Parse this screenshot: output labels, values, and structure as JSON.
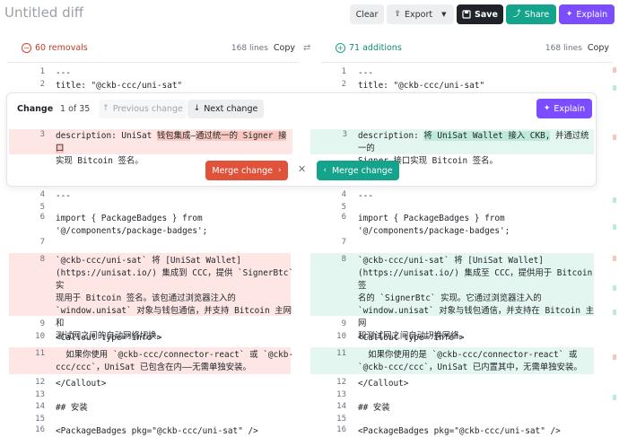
{
  "header": {
    "title": "Untitled diff",
    "clear_label": "Clear",
    "export_label": "Export",
    "save_label": "Save",
    "share_label": "Share",
    "explain_label": "Explain"
  },
  "left_pane": {
    "summary": "60 removals",
    "lines": "168 lines",
    "copy_label": "Copy"
  },
  "right_pane": {
    "summary": "71 additions",
    "lines": "168 lines",
    "copy_label": "Copy"
  },
  "change_panel": {
    "label": "Change",
    "counter": "1 of 35",
    "prev_label": "Previous change",
    "next_label": "Next change",
    "explain_label": "Explain",
    "merge_left_label": "Merge change",
    "merge_right_label": "Merge change"
  },
  "left_lines": {
    "l1": {
      "n": "1",
      "t": "---"
    },
    "l2": {
      "n": "2",
      "t": "title: \"@ckb-ccc/uni-sat\""
    },
    "l3a": "description: UniSat ",
    "l3b": "钱包集成",
    "l3c": "—",
    "l3d": "通过统一的 Signer 接口",
    "l3e": "实现 Bitcoin 签名。",
    "l3n": "3",
    "l4": {
      "n": "4",
      "t": "---"
    },
    "l5": {
      "n": "5",
      "t": ""
    },
    "l6": {
      "n": "6",
      "t": "import { PackageBadges } from\n'@/components/package-badges';"
    },
    "l7": {
      "n": "7",
      "t": ""
    },
    "l8": {
      "n": "8",
      "t": "`@ckb-ccc/uni-sat` 将 [UniSat Wallet]\n(https://unisat.io/) 集成到 CCC，提供 `SignerBtc` 实\n现用于 Bitcoin 签名。该包通过浏览器注入的\n`window.unisat` 对象与钱包通信，并支持 Bitcoin 主网和\n测试网之间的自动网络切换。"
    },
    "l9": {
      "n": "9",
      "t": ""
    },
    "l10": {
      "n": "10",
      "t": "<Callout type=\"info\">"
    },
    "l11": {
      "n": "11",
      "t": "  如果你使用 `@ckb-ccc/connector-react` 或 `@ckb-\nccc/ccc`，UniSat 已包含在内——无需单独安装。"
    },
    "l12": {
      "n": "12",
      "t": "</Callout>"
    },
    "l13": {
      "n": "13",
      "t": ""
    },
    "l14": {
      "n": "14",
      "t": "## 安装"
    },
    "l15": {
      "n": "15",
      "t": ""
    },
    "l16": {
      "n": "16",
      "t": "<PackageBadges pkg=\"@ckb-ccc/uni-sat\" />"
    }
  },
  "right_lines": {
    "r1": {
      "n": "1",
      "t": "---"
    },
    "r2": {
      "n": "2",
      "t": "title: \"@ckb-ccc/uni-sat\""
    },
    "r3a": "description: ",
    "r3b": "将 UniSat Wallet 接入 CKB,",
    "r3c": " 并通过统一的",
    "r3d": "Signer 接口实现 Bitcoin 签名。",
    "r3n": "3",
    "r4": {
      "n": "4",
      "t": "---"
    },
    "r5": {
      "n": "5",
      "t": ""
    },
    "r6": {
      "n": "6",
      "t": "import { PackageBadges } from\n'@/components/package-badges';"
    },
    "r7": {
      "n": "7",
      "t": ""
    },
    "r8": {
      "n": "8",
      "t": "`@ckb-ccc/uni-sat` 将 [UniSat Wallet]\n(https://unisat.io/) 集成至 CCC，提供用于 Bitcoin 签\n名的 `SignerBtc` 实现。它通过浏览器注入的\n`window.unisat` 对象与钱包通信，并支持在 Bitcoin 主网\n和测试网之间自动切换网络。"
    },
    "r9": {
      "n": "9",
      "t": ""
    },
    "r10": {
      "n": "10",
      "t": "<Callout type=\"info\">"
    },
    "r11": {
      "n": "11",
      "t": "  如果你使用的是 `@ckb-ccc/connector-react` 或\n`@ckb-ccc/ccc`，UniSat 已内置其中，无需单独安装。"
    },
    "r12": {
      "n": "12",
      "t": "</Callout>"
    },
    "r13": {
      "n": "13",
      "t": ""
    },
    "r14": {
      "n": "14",
      "t": "## 安装"
    },
    "r15": {
      "n": "15",
      "t": ""
    },
    "r16": {
      "n": "16",
      "t": "<PackageBadges pkg=\"@ckb-ccc/uni-sat\" />"
    }
  },
  "colors": {
    "accent": "#7c4dff",
    "teal": "#14a38b",
    "removal": "#e0533a",
    "save": "#1f2329"
  },
  "icons": [
    "upload-icon",
    "chevron-down-icon",
    "floppy-icon",
    "share-icon",
    "sparkle-icon",
    "minus-circle-icon",
    "plus-circle-icon",
    "swap-icon",
    "arrow-up-icon",
    "arrow-down-icon",
    "chevron-right-icon",
    "chevron-left-icon",
    "close-icon"
  ]
}
